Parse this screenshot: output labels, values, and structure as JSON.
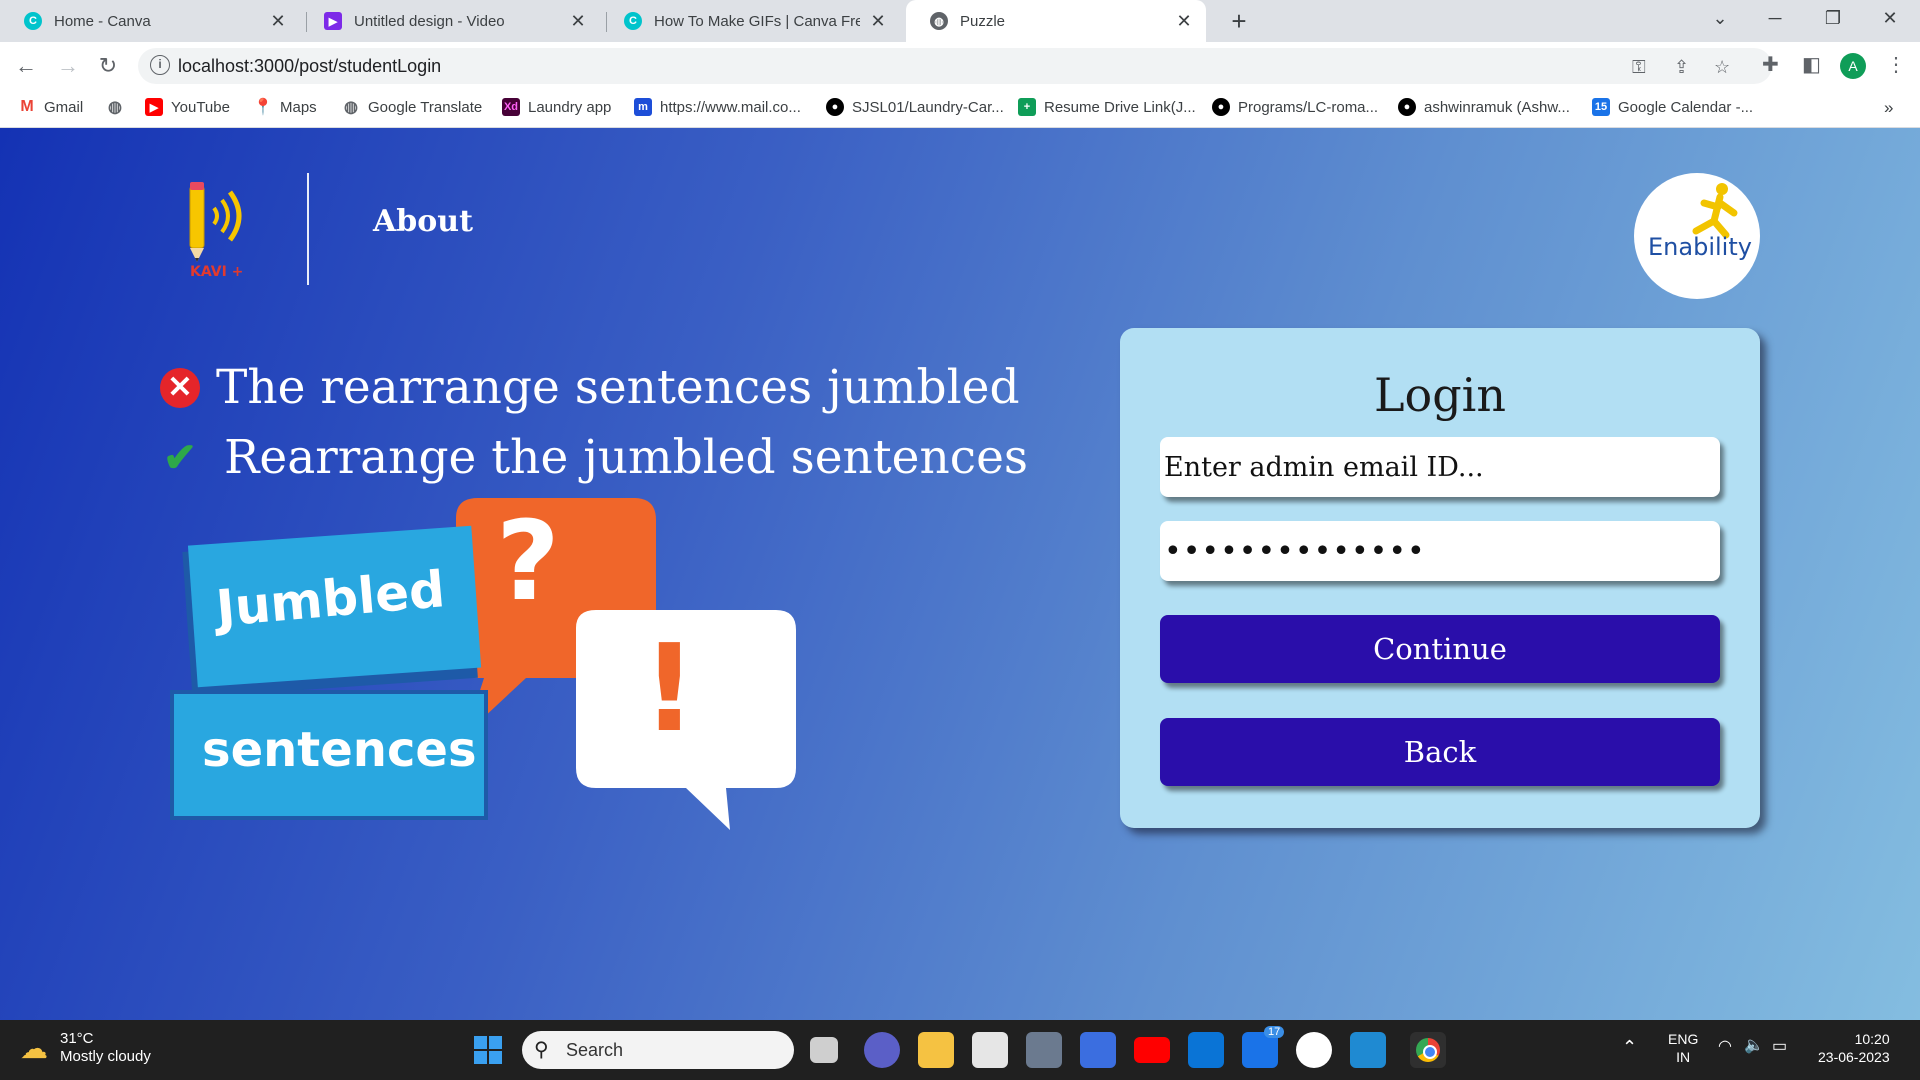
{
  "browser": {
    "tabs": [
      {
        "title": "Home - Canva",
        "icon": "canva-icon"
      },
      {
        "title": "Untitled design - Video",
        "icon": "video-icon"
      },
      {
        "title": "How To Make GIFs | Canva Free C",
        "icon": "canva-icon"
      },
      {
        "title": "Puzzle",
        "icon": "globe-icon",
        "active": true
      }
    ],
    "url": "localhost:3000/post/studentLogin",
    "profile_initial": "A",
    "bookmarks": [
      {
        "label": "Gmail",
        "icon": "gmail-icon",
        "color": "#ea4335"
      },
      {
        "label": "",
        "icon": "globe-icon",
        "color": "#5f6368"
      },
      {
        "label": "YouTube",
        "icon": "youtube-icon",
        "color": "#ff0000"
      },
      {
        "label": "Maps",
        "icon": "maps-icon",
        "color": "#34a853"
      },
      {
        "label": "Google Translate",
        "icon": "globe-icon",
        "color": "#5f6368"
      },
      {
        "label": "Laundry app",
        "icon": "xd-icon",
        "color": "#470137"
      },
      {
        "label": "https://www.mail.co...",
        "icon": "mail-com-icon",
        "color": "#1d4ed8"
      },
      {
        "label": "SJSL01/Laundry-Car...",
        "icon": "github-icon",
        "color": "#000000"
      },
      {
        "label": "Resume Drive Link(J...",
        "icon": "sheets-icon",
        "color": "#0f9d58"
      },
      {
        "label": "Programs/LC-roma...",
        "icon": "github-icon",
        "color": "#000000"
      },
      {
        "label": "ashwinramuk (Ashw...",
        "icon": "github-icon",
        "color": "#000000"
      },
      {
        "label": "Google Calendar -...",
        "icon": "calendar-icon",
        "color": "#1a73e8"
      }
    ],
    "bookmarks_overflow": "»"
  },
  "page": {
    "logo_text": "KAVI +",
    "nav_about": "About",
    "partner_logo": "Enability",
    "wrong_sentence": "The rearrange sentences jumbled",
    "right_sentence": "Rearrange the jumbled sentences",
    "illustration": {
      "word1": "Jumbled",
      "word2": "sentences",
      "q": "?",
      "ex": "!"
    },
    "login": {
      "title": "Login",
      "email_placeholder": "Enter admin email ID...",
      "password_value": "••••••••••••••",
      "continue_label": "Continue",
      "back_label": "Back"
    },
    "colors": {
      "button": "#2a0eaa",
      "card": "#b2dff3",
      "gradient_start": "#1432b4",
      "gradient_end": "#84bde0"
    }
  },
  "taskbar": {
    "temp": "31°C",
    "weather": "Mostly cloudy",
    "search": "Search",
    "mail_badge": "17",
    "lang1": "ENG",
    "lang2": "IN",
    "time": "10:20",
    "date": "23-06-2023"
  }
}
